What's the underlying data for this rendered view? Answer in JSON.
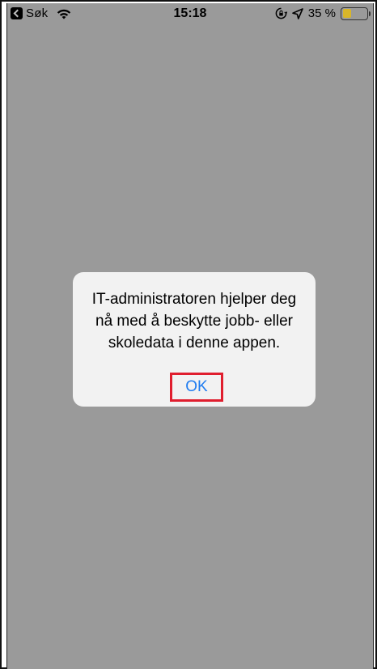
{
  "status_bar": {
    "back_label": "Søk",
    "time": "15:18",
    "battery_percent_text": "35 %",
    "battery_level": 0.35,
    "battery_color": "#d8b62a",
    "icons": [
      "back-icon",
      "wifi-icon",
      "rotation-lock-icon",
      "location-icon",
      "battery-icon"
    ]
  },
  "alert": {
    "message": "IT-administratoren hjelper deg nå med å beskytte jobb- eller skoledata i denne appen.",
    "ok_label": "OK",
    "ok_highlight_color": "#e01e2e",
    "ok_text_color": "#1f7cf0"
  },
  "colors": {
    "dim_background": "#9a9a9a",
    "alert_background": "#f2f2f2"
  }
}
